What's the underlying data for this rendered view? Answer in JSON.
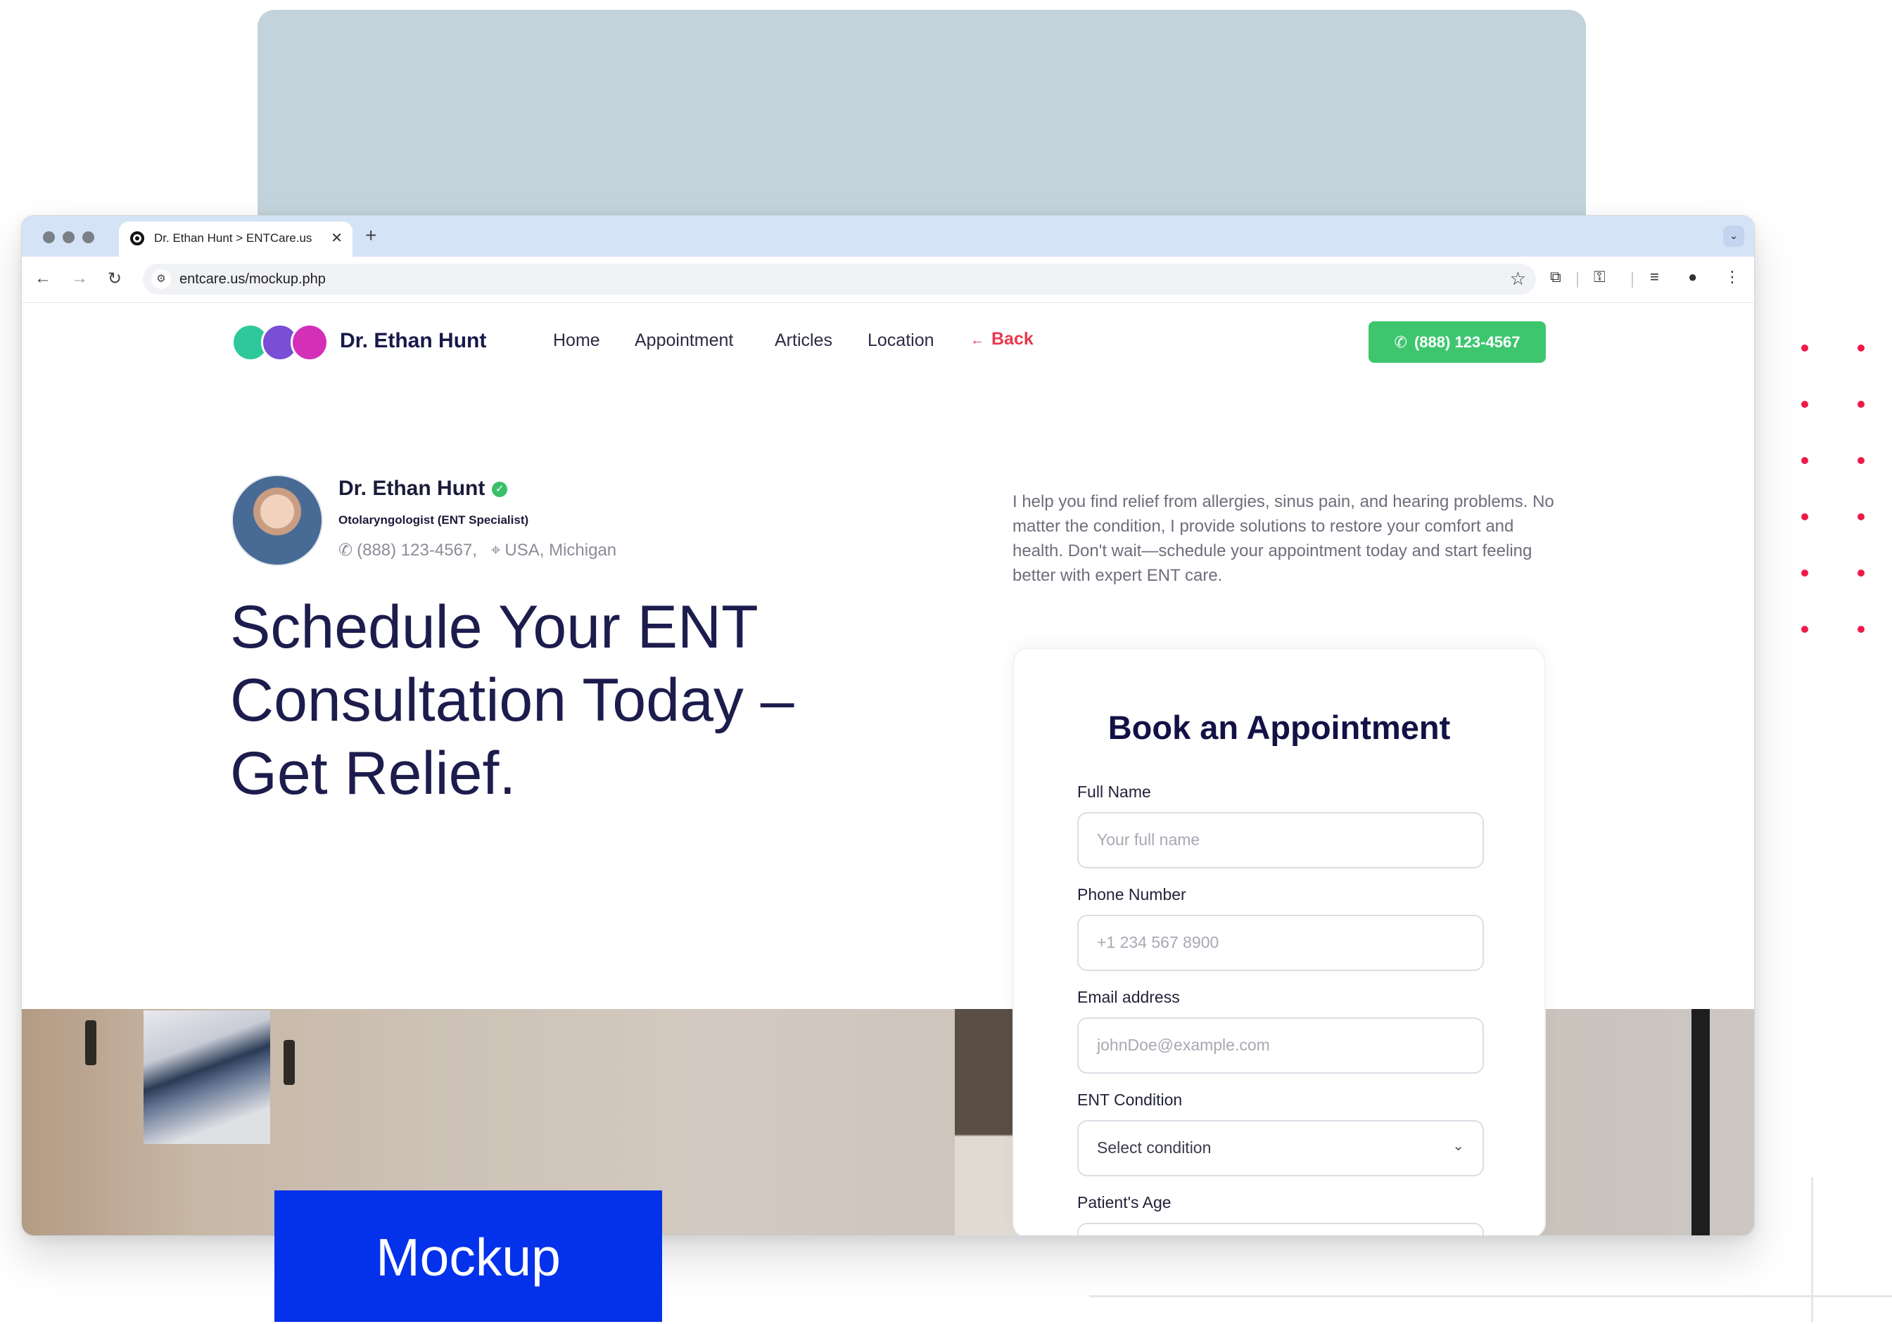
{
  "browser": {
    "tab_title": "Dr. Ethan Hunt > ENTCare.us",
    "tab_close": "✕",
    "new_tab": "+",
    "url": "entcare.us/mockup.php"
  },
  "site": {
    "brand": "Dr. Ethan Hunt",
    "nav": [
      "Home",
      "Appointment",
      "Articles",
      "Location"
    ],
    "back": "Back",
    "phone_button": "(888) 123-4567",
    "colors": {
      "accent_green": "#3ec66f",
      "back_red": "#e8394d",
      "logo": [
        "#2ec99a",
        "#7a4fd6",
        "#d42fb8"
      ]
    }
  },
  "doctor": {
    "name": "Dr. Ethan Hunt",
    "role": "Otolaryngologist (ENT Specialist)",
    "phone": "(888) 123-4567,",
    "location": "USA, Michigan"
  },
  "hero": {
    "line1": "Schedule Your ENT",
    "line2": "Consultation Today –",
    "line3": "Get Relief."
  },
  "intro": "I help you find relief from allergies, sinus pain, and hearing problems. No matter the condition, I provide solutions to restore your comfort and health. Don't wait—schedule your appointment today and start feeling better with expert ENT care.",
  "form": {
    "title": "Book an Appointment",
    "fields": [
      {
        "label": "Full Name",
        "placeholder": "Your full name"
      },
      {
        "label": "Phone Number",
        "placeholder": "+1 234 567 8900"
      },
      {
        "label": "Email address",
        "placeholder": "johnDoe@example.com"
      },
      {
        "label": "ENT Condition",
        "value": "Select condition"
      },
      {
        "label": "Patient's Age"
      }
    ]
  },
  "badge": "Mockup",
  "icons": {
    "back_arrow": "←",
    "forward_arrow": "→",
    "reload": "↻",
    "site_settings": "⚙",
    "bookmark_star": "☆",
    "extensions": "⧉",
    "passwords": "⚿",
    "media": "≡",
    "profile": "●",
    "menu": "⋮",
    "chevron_down": "⌄",
    "phone": "✆",
    "pin": "⌖",
    "check": "✓",
    "left_arrow": "←"
  }
}
